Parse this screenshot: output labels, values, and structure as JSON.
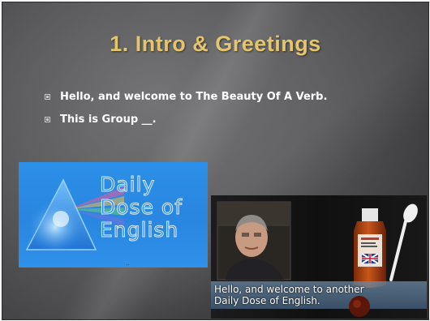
{
  "slide": {
    "title": "1. Intro & Greetings",
    "bullets": [
      "Hello, and welcome to The Beauty Of A Verb.",
      "This is Group __."
    ]
  },
  "logo": {
    "lines": [
      "Daily",
      "Dose of",
      "English"
    ],
    "dots": "..",
    "colors": {
      "background": "#2b8fe8",
      "text": "#2c8ae6"
    }
  },
  "video": {
    "caption_line1": "Hello, and welcome to another",
    "caption_line2": "Daily Dose of English."
  },
  "colors": {
    "title": "#e4c56c",
    "slide_bg": "#58585a"
  }
}
